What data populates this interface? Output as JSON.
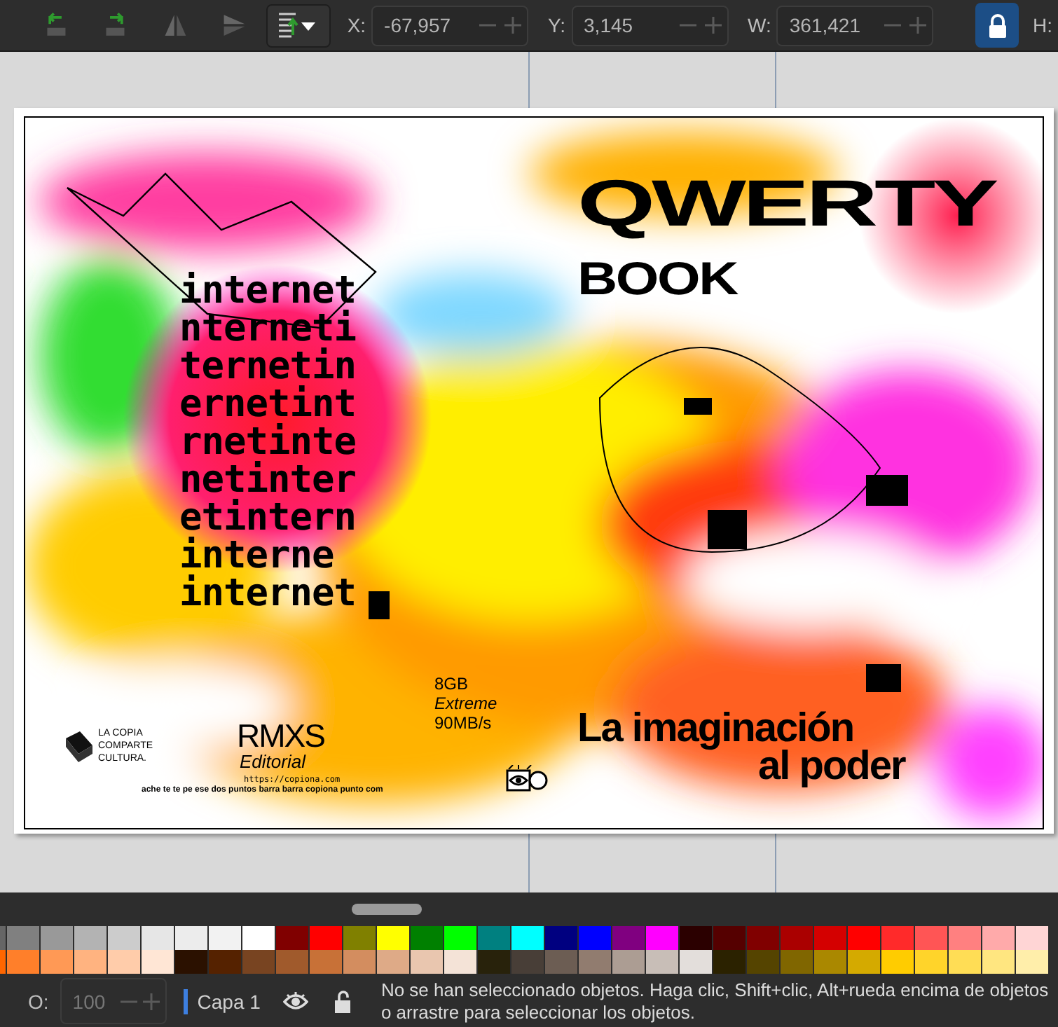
{
  "toolbar": {
    "fields": [
      {
        "label": "X:",
        "value": "-67,957"
      },
      {
        "label": "Y:",
        "value": "3,145"
      },
      {
        "label": "W:",
        "value": "361,421"
      }
    ],
    "lock": {
      "on": true
    },
    "next_label": "H:"
  },
  "document": {
    "back_cover": {
      "repeated_word_lines": [
        "internet",
        "nterneti",
        "ternetin",
        "ernetint",
        "rnetinte",
        "netinter",
        "etintern",
        "interne",
        "internet"
      ],
      "slogan": [
        "LA COPIA",
        "COMPARTE",
        "CULTURA."
      ],
      "publisher": {
        "logo": "RMXS",
        "subtitle": "Editorial",
        "url": "https://copiona.com",
        "spelled_url": "ache te te pe ese dos puntos barra barra copiona punto com"
      },
      "card_text": [
        "8GB",
        "Extreme",
        "90MB/s"
      ]
    },
    "front_cover": {
      "title": "QWERTY",
      "subtitle": "BOOK",
      "tagline": [
        "La imaginación",
        "al poder"
      ]
    }
  },
  "palette": {
    "rows": [
      [
        {
          "color": "#666666"
        },
        {
          "color": "#808080"
        },
        {
          "color": "#999999"
        },
        {
          "color": "#b3b3b3"
        },
        {
          "color": "#cccccc"
        },
        {
          "color": "#e6e6e6"
        },
        {
          "color": "#ececec"
        },
        {
          "color": "#f2f2f2"
        },
        {
          "color": "#ffffff"
        },
        {
          "color": "#800000"
        },
        {
          "color": "#ff0000"
        },
        {
          "color": "#808000"
        },
        {
          "color": "#ffff00"
        },
        {
          "color": "#008000"
        },
        {
          "color": "#00ff00"
        },
        {
          "color": "#008080"
        },
        {
          "color": "#00ffff"
        },
        {
          "color": "#000080"
        },
        {
          "color": "#0000ff"
        },
        {
          "color": "#800080"
        },
        {
          "color": "#ff00ff"
        },
        {
          "color": "#2b0000"
        },
        {
          "color": "#550000"
        },
        {
          "color": "#800000"
        },
        {
          "color": "#aa0000"
        },
        {
          "color": "#d40000"
        },
        {
          "color": "#ff0000"
        },
        {
          "color": "#ff2a2a"
        },
        {
          "color": "#ff5555"
        },
        {
          "color": "#ff8080"
        },
        {
          "color": "#ffaaaa"
        },
        {
          "color": "#ffd5d5"
        }
      ],
      [
        {
          "color": "#ff6600"
        },
        {
          "color": "#ff7f2a"
        },
        {
          "color": "#ff9955"
        },
        {
          "color": "#ffb380"
        },
        {
          "color": "#ffccaa"
        },
        {
          "color": "#ffe6d5"
        },
        {
          "color": "#2b1100"
        },
        {
          "color": "#552200"
        },
        {
          "color": "#784421"
        },
        {
          "color": "#a05a2c"
        },
        {
          "color": "#c87137"
        },
        {
          "color": "#d38d5f"
        },
        {
          "color": "#deaa87"
        },
        {
          "color": "#e9c6af"
        },
        {
          "color": "#f4e3d7"
        },
        {
          "color": "#28220b"
        },
        {
          "color": "#483e37"
        },
        {
          "color": "#6c5d53"
        },
        {
          "color": "#917c6f"
        },
        {
          "color": "#ac9d93"
        },
        {
          "color": "#c8beb7"
        },
        {
          "color": "#e3dedb"
        },
        {
          "color": "#2b2200"
        },
        {
          "color": "#554400"
        },
        {
          "color": "#806600"
        },
        {
          "color": "#aa8800"
        },
        {
          "color": "#d4aa00"
        },
        {
          "color": "#ffcc00"
        },
        {
          "color": "#ffd42a"
        },
        {
          "color": "#ffdd55"
        },
        {
          "color": "#ffe680"
        },
        {
          "color": "#ffeeaa"
        }
      ]
    ]
  },
  "status_bar": {
    "opacity": {
      "label": "O:",
      "value": "100",
      "disabled": true
    },
    "layer": "Capa 1",
    "message": "No se han seleccionado objetos. Haga clic, Shift+clic, Alt+rueda encima de objetos o arrastre para seleccionar los objetos."
  }
}
